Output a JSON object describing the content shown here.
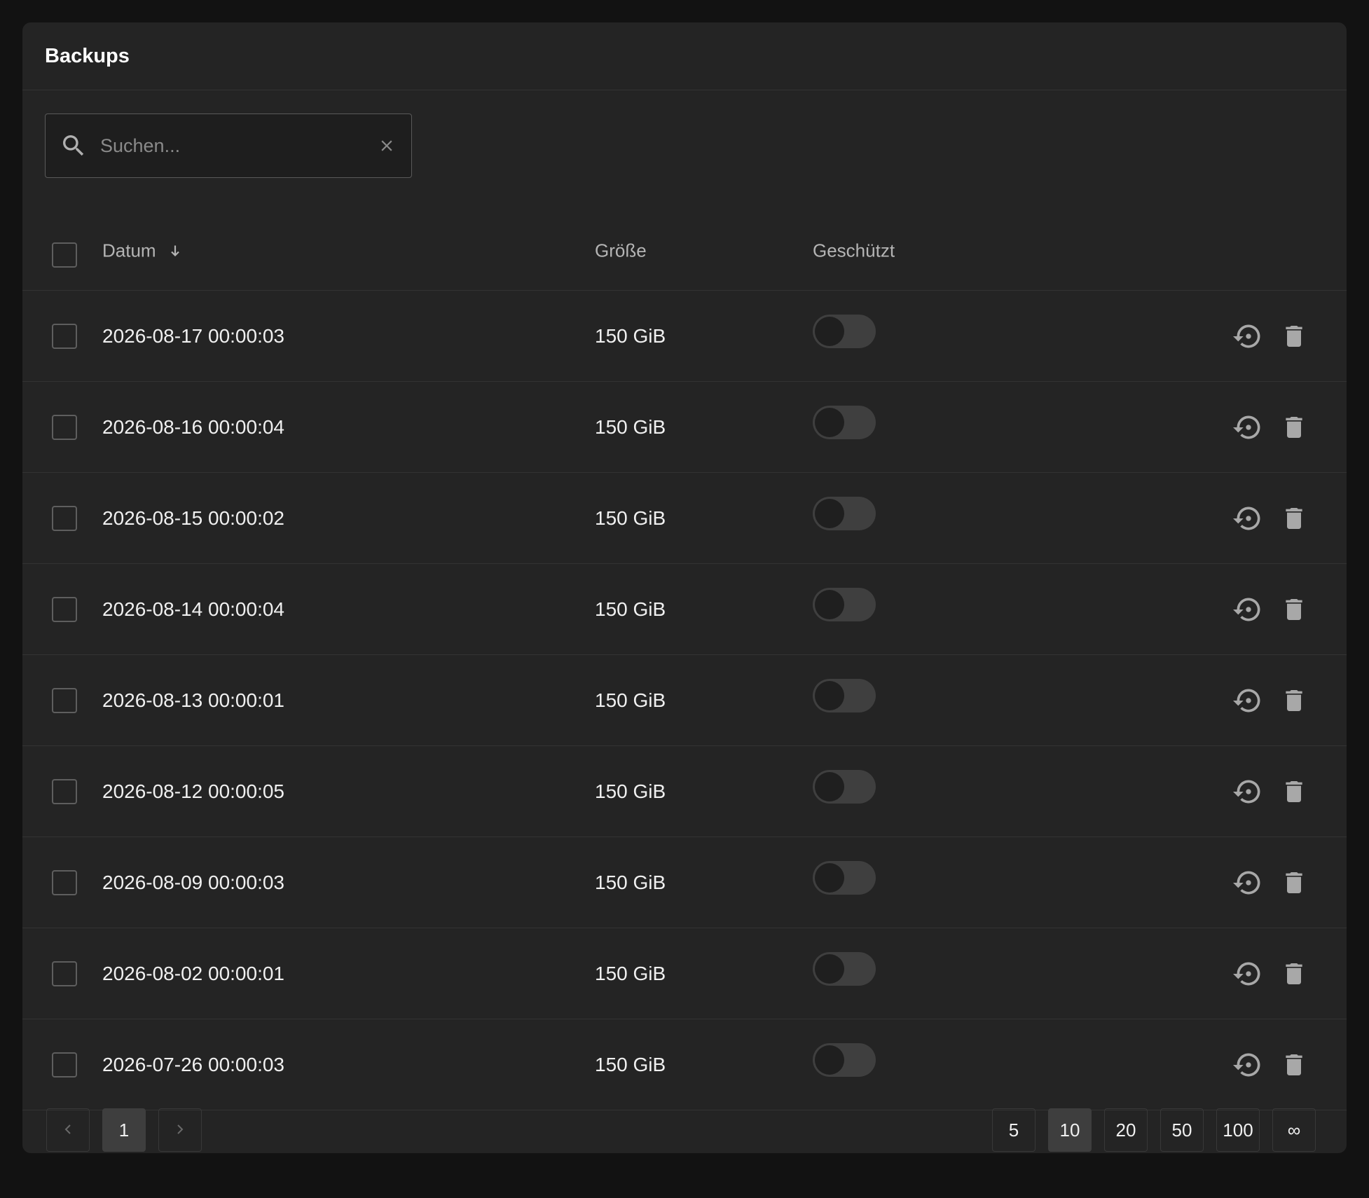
{
  "card": {
    "title": "Backups"
  },
  "search": {
    "placeholder": "Suchen...",
    "value": ""
  },
  "table": {
    "columns": {
      "date": "Datum",
      "size": "Größe",
      "protected": "Geschützt"
    },
    "sort": {
      "column": "date",
      "direction": "descending",
      "icon": "arrow-down-icon"
    },
    "rows": [
      {
        "date": "2026-08-17 00:00:03",
        "size": "150 GiB",
        "protected": false
      },
      {
        "date": "2026-08-16 00:00:04",
        "size": "150 GiB",
        "protected": false
      },
      {
        "date": "2026-08-15 00:00:02",
        "size": "150 GiB",
        "protected": false
      },
      {
        "date": "2026-08-14 00:00:04",
        "size": "150 GiB",
        "protected": false
      },
      {
        "date": "2026-08-13 00:00:01",
        "size": "150 GiB",
        "protected": false
      },
      {
        "date": "2026-08-12 00:00:05",
        "size": "150 GiB",
        "protected": false
      },
      {
        "date": "2026-08-09 00:00:03",
        "size": "150 GiB",
        "protected": false
      },
      {
        "date": "2026-08-02 00:00:01",
        "size": "150 GiB",
        "protected": false
      },
      {
        "date": "2026-07-26 00:00:03",
        "size": "150 GiB",
        "protected": false
      }
    ],
    "row_actions": [
      "restore-icon",
      "trash-icon"
    ]
  },
  "pagination": {
    "prev_icon": "chevron-left-icon",
    "next_icon": "chevron-right-icon",
    "current_page": "1",
    "page_sizes": [
      "5",
      "10",
      "20",
      "50",
      "100",
      "∞"
    ],
    "selected_page_size": "10"
  },
  "colors": {
    "background": "#121212",
    "card": "#242424",
    "text": "#f0f0f0",
    "muted": "#b4b4b4",
    "icon": "#a8a8a8",
    "toggle_track": "#3f3f3f"
  }
}
